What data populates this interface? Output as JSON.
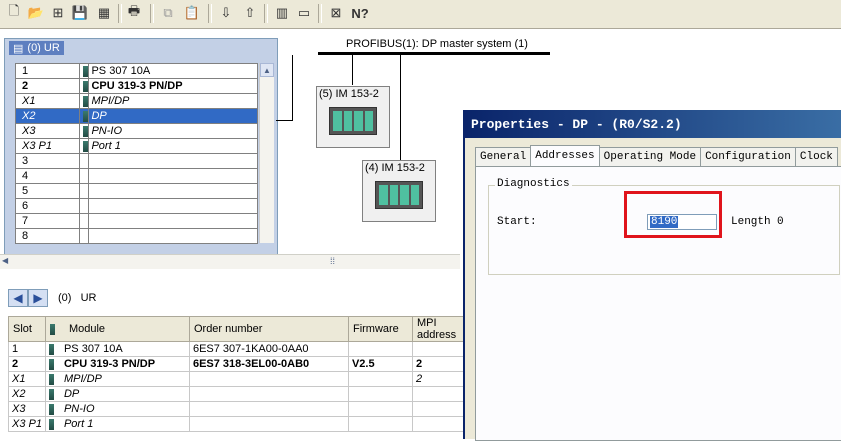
{
  "toolbar": {
    "icons": [
      "new-icon",
      "open-icon",
      "network-icon",
      "save-icon",
      "save-compile-icon",
      "print-icon",
      "copy-icon",
      "paste-icon",
      "download-icon",
      "upload-icon",
      "catalog-icon",
      "window-icon",
      "netpro-icon",
      "help-icon"
    ]
  },
  "rack": {
    "title": "(0) UR",
    "rows": [
      {
        "slot": "1",
        "module": "PS 307 10A",
        "style": ""
      },
      {
        "slot": "2",
        "module": "CPU 319-3 PN/DP",
        "style": "b"
      },
      {
        "slot": "X1",
        "module": "MPI/DP",
        "style": "it"
      },
      {
        "slot": "X2",
        "module": "DP",
        "style": "it sel"
      },
      {
        "slot": "X3",
        "module": "PN-IO",
        "style": "it"
      },
      {
        "slot": "X3 P1",
        "module": "Port 1",
        "style": "it"
      },
      {
        "slot": "3",
        "module": "",
        "style": ""
      },
      {
        "slot": "4",
        "module": "",
        "style": ""
      },
      {
        "slot": "5",
        "module": "",
        "style": ""
      },
      {
        "slot": "6",
        "module": "",
        "style": ""
      },
      {
        "slot": "7",
        "module": "",
        "style": ""
      },
      {
        "slot": "8",
        "module": "",
        "style": ""
      }
    ]
  },
  "network": {
    "bus_label": "PROFIBUS(1): DP master system (1)",
    "stations": [
      "(5) IM 153-2",
      "(4) IM 153-2"
    ]
  },
  "lower": {
    "title": "(0)   UR",
    "columns": [
      "Slot",
      "Module",
      "Order number",
      "Firmware",
      "MPI address"
    ],
    "rows": [
      {
        "slot": "1",
        "module": "PS 307 10A",
        "order": "6ES7 307-1KA00-0AA0",
        "firmware": "",
        "mpi": "",
        "style": ""
      },
      {
        "slot": "2",
        "module": "CPU 319-3 PN/DP",
        "order": "6ES7 318-3EL00-0AB0",
        "firmware": "V2.5",
        "mpi": "2",
        "style": "b"
      },
      {
        "slot": "X1",
        "module": "MPI/DP",
        "order": "",
        "firmware": "",
        "mpi": "2",
        "style": "it"
      },
      {
        "slot": "X2",
        "module": "DP",
        "order": "",
        "firmware": "",
        "mpi": "",
        "style": "it"
      },
      {
        "slot": "X3",
        "module": "PN-IO",
        "order": "",
        "firmware": "",
        "mpi": "",
        "style": "it"
      },
      {
        "slot": "X3 P1",
        "module": "Port 1",
        "order": "",
        "firmware": "",
        "mpi": "",
        "style": "it"
      }
    ]
  },
  "dialog": {
    "title": "Properties - DP - (R0/S2.2)",
    "tabs": [
      "General",
      "Addresses",
      "Operating Mode",
      "Configuration",
      "Clock"
    ],
    "active_tab": "Addresses",
    "group_label": "Diagnostics",
    "start_label": "Start:",
    "start_value": "8190",
    "length_label": "Length",
    "length_value": "0"
  },
  "highlight_color": "#e0141c"
}
